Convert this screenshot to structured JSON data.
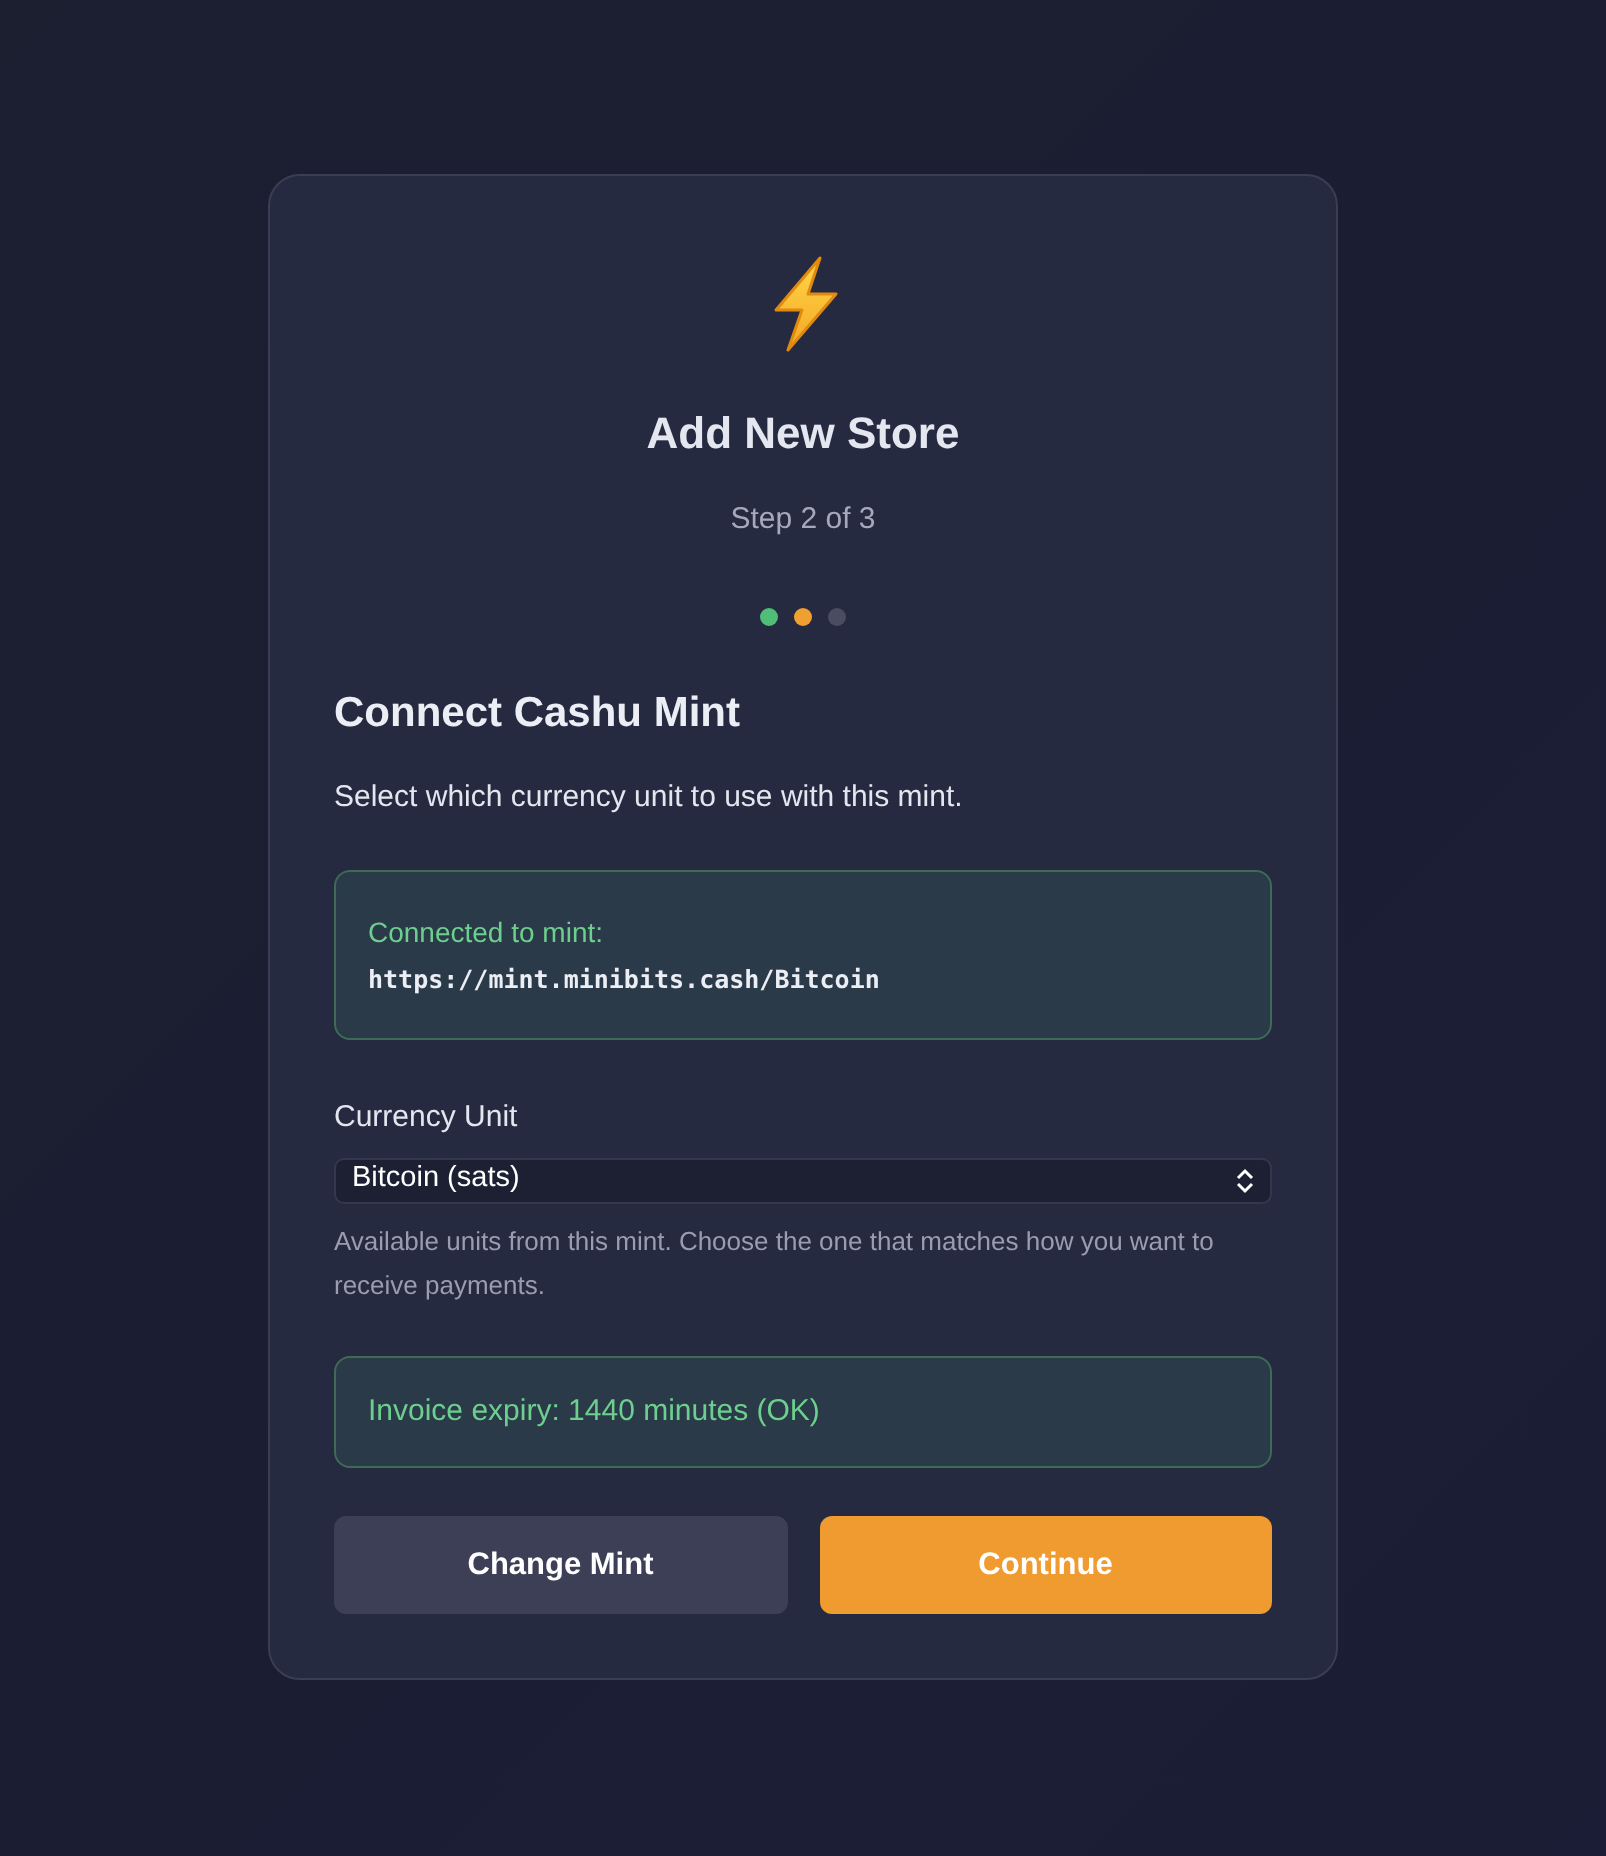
{
  "header": {
    "title": "Add New Store",
    "step": "Step 2 of 3"
  },
  "steps": [
    {
      "color": "#4fbf77"
    },
    {
      "color": "#f0a030"
    },
    {
      "color": "#4a4d62"
    }
  ],
  "section": {
    "title": "Connect Cashu Mint",
    "description": "Select which currency unit to use with this mint."
  },
  "mint_box": {
    "label": "Connected to mint:",
    "url": "https://mint.minibits.cash/Bitcoin"
  },
  "currency": {
    "label": "Currency Unit",
    "value": "Bitcoin (sats)",
    "help": "Available units from this mint. Choose the one that matches how you want to receive payments."
  },
  "expiry_notice": "Invoice expiry: 1440 minutes (OK)",
  "buttons": [
    {
      "label": "Change Mint",
      "kind": "secondary"
    },
    {
      "label": "Continue",
      "kind": "primary"
    }
  ]
}
